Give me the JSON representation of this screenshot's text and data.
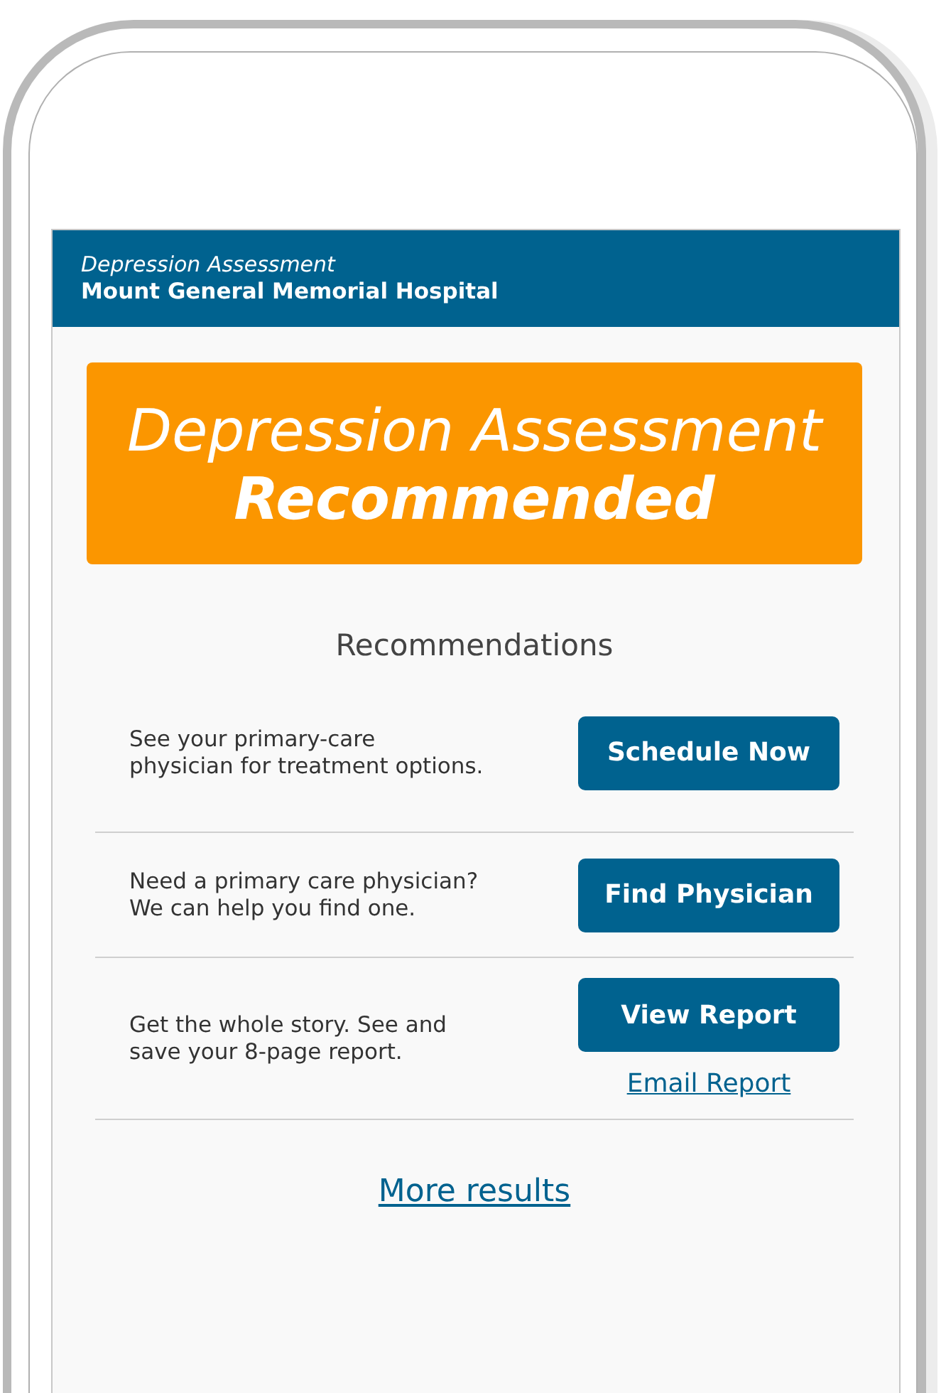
{
  "header": {
    "subtitle": "Depression Assessment",
    "title": "Mount General Memorial Hospital"
  },
  "banner": {
    "line_1": "Depression Assessment",
    "line_2": "Recommended"
  },
  "recommendations": {
    "heading": "Recommendations",
    "items": [
      {
        "text": "See your primary-care physician for treatment options.",
        "button": "Schedule Now"
      },
      {
        "text": "Need a primary care physician? We can help you find one.",
        "button": "Find Physician"
      },
      {
        "text": "Get the whole story. See and save your 8-page report.",
        "button": "View Report",
        "link": "Email Report"
      }
    ]
  },
  "more_link": "More results"
}
